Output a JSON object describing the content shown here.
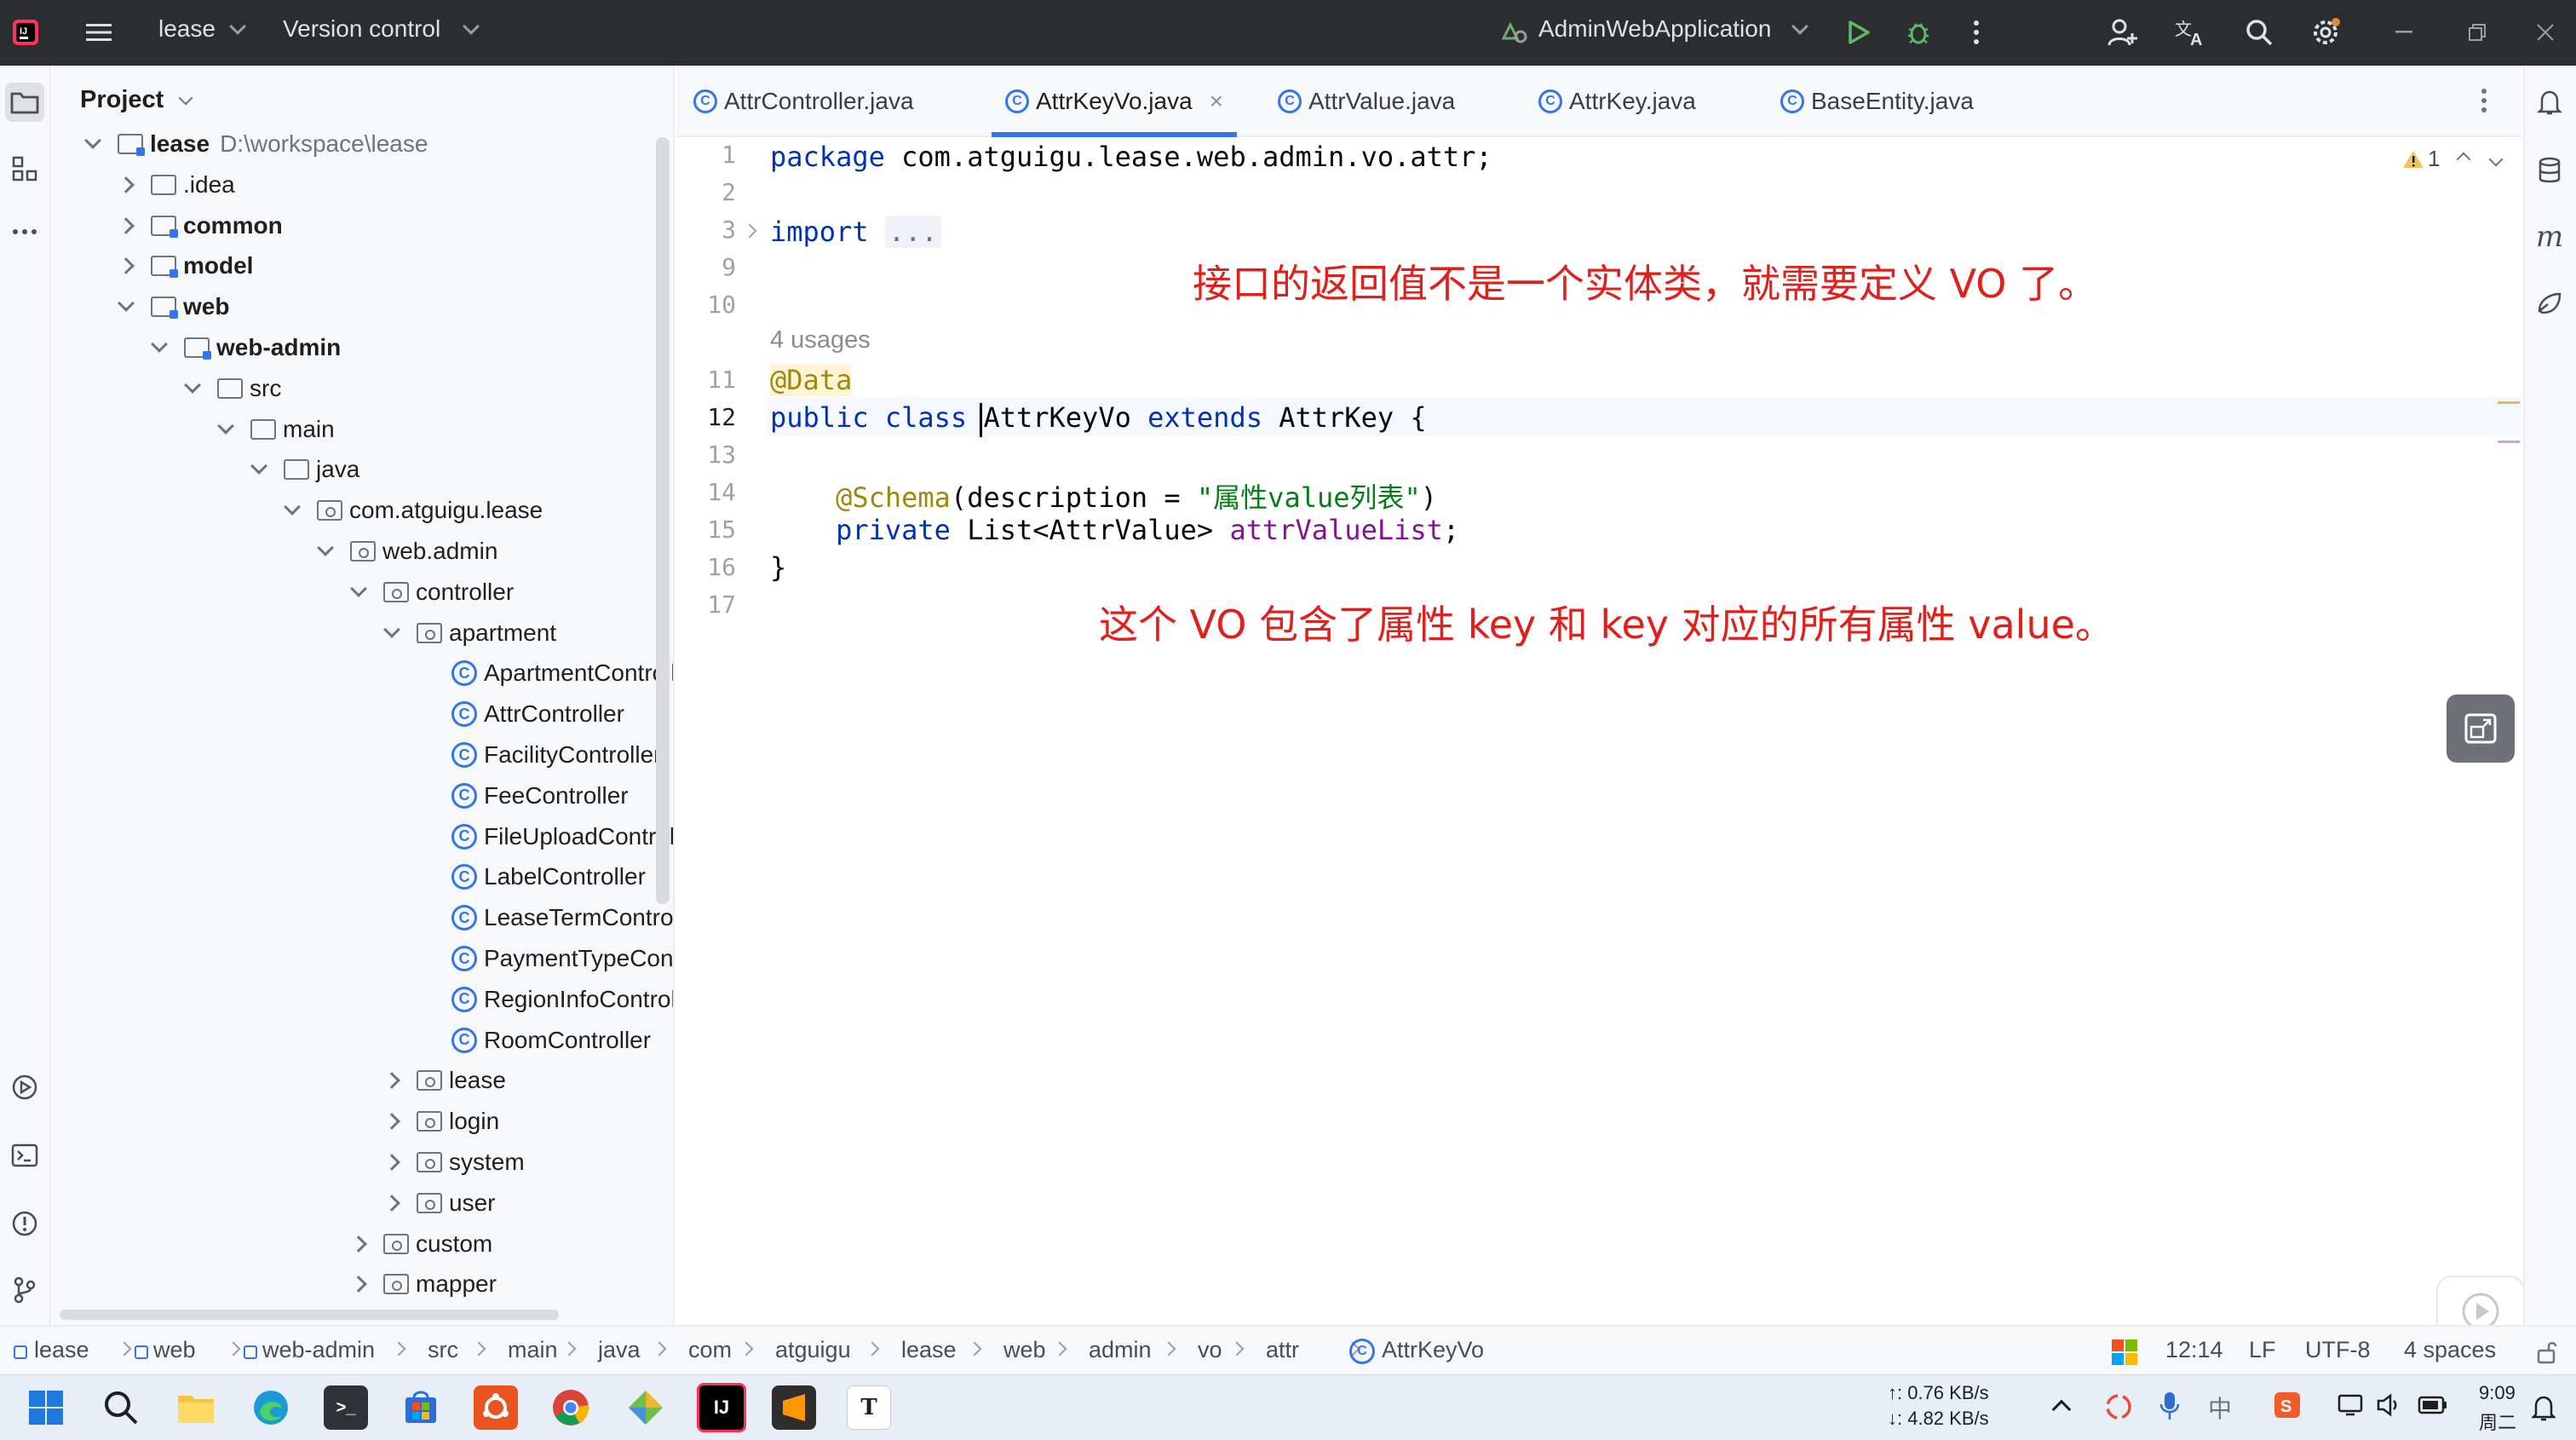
{
  "title_bar": {
    "project_name": "lease",
    "vcs_label": "Version control",
    "run_config": "AdminWebApplication"
  },
  "project_panel": {
    "title": "Project",
    "tree": [
      {
        "label": "lease",
        "path": "D:\\workspace\\lease",
        "level": 0,
        "arrow": "open",
        "icon": "module",
        "bold": true
      },
      {
        "label": ".idea",
        "level": 1,
        "arrow": "closed",
        "icon": "folder"
      },
      {
        "label": "common",
        "level": 1,
        "arrow": "closed",
        "icon": "module",
        "bold": true
      },
      {
        "label": "model",
        "level": 1,
        "arrow": "closed",
        "icon": "module",
        "bold": true
      },
      {
        "label": "web",
        "level": 1,
        "arrow": "open",
        "icon": "module",
        "bold": true
      },
      {
        "label": "web-admin",
        "level": 2,
        "arrow": "open",
        "icon": "module",
        "bold": true
      },
      {
        "label": "src",
        "level": 3,
        "arrow": "open",
        "icon": "folder"
      },
      {
        "label": "main",
        "level": 4,
        "arrow": "open",
        "icon": "folder"
      },
      {
        "label": "java",
        "level": 5,
        "arrow": "open",
        "icon": "source-folder"
      },
      {
        "label": "com.atguigu.lease",
        "level": 6,
        "arrow": "open",
        "icon": "package"
      },
      {
        "label": "web.admin",
        "level": 7,
        "arrow": "open",
        "icon": "package"
      },
      {
        "label": "controller",
        "level": 8,
        "arrow": "open",
        "icon": "package"
      },
      {
        "label": "apartment",
        "level": 9,
        "arrow": "open",
        "icon": "package"
      },
      {
        "label": "ApartmentControll",
        "level": 10,
        "arrow": "none",
        "icon": "class"
      },
      {
        "label": "AttrController",
        "level": 10,
        "arrow": "none",
        "icon": "class"
      },
      {
        "label": "FacilityController",
        "level": 10,
        "arrow": "none",
        "icon": "class"
      },
      {
        "label": "FeeController",
        "level": 10,
        "arrow": "none",
        "icon": "class"
      },
      {
        "label": "FileUploadControll",
        "level": 10,
        "arrow": "none",
        "icon": "class"
      },
      {
        "label": "LabelController",
        "level": 10,
        "arrow": "none",
        "icon": "class"
      },
      {
        "label": "LeaseTermControl",
        "level": 10,
        "arrow": "none",
        "icon": "class"
      },
      {
        "label": "PaymentTypeCont",
        "level": 10,
        "arrow": "none",
        "icon": "class"
      },
      {
        "label": "RegionInfoControll",
        "level": 10,
        "arrow": "none",
        "icon": "class"
      },
      {
        "label": "RoomController",
        "level": 10,
        "arrow": "none",
        "icon": "class"
      },
      {
        "label": "lease",
        "level": 9,
        "arrow": "closed",
        "icon": "package"
      },
      {
        "label": "login",
        "level": 9,
        "arrow": "closed",
        "icon": "package"
      },
      {
        "label": "system",
        "level": 9,
        "arrow": "closed",
        "icon": "package"
      },
      {
        "label": "user",
        "level": 9,
        "arrow": "closed",
        "icon": "package"
      },
      {
        "label": "custom",
        "level": 8,
        "arrow": "closed",
        "icon": "package"
      },
      {
        "label": "mapper",
        "level": 8,
        "arrow": "closed",
        "icon": "package"
      }
    ]
  },
  "tabs": [
    {
      "label": "AttrController.java",
      "active": false
    },
    {
      "label": "AttrKeyVo.java",
      "active": true,
      "close": "×"
    },
    {
      "label": "AttrValue.java",
      "active": false
    },
    {
      "label": "AttrKey.java",
      "active": false
    },
    {
      "label": "BaseEntity.java",
      "active": false
    }
  ],
  "editor": {
    "line_numbers": [
      "1",
      "2",
      "3",
      "9",
      "10",
      "",
      "11",
      "12",
      "13",
      "14",
      "15",
      "16",
      "17"
    ],
    "warning_count": "1",
    "code": {
      "l1_kw": "package",
      "l1_rest": " com.atguigu.lease.web.admin.vo.attr;",
      "l3_kw": "import",
      "l3_fold": "...",
      "usages": "4 usages",
      "l11_ann": "@Data",
      "l12_kw1": "public",
      "l12_kw2": "class",
      "l12_name": "AttrKeyVo",
      "l12_kw3": "extends",
      "l12_rest": " AttrKey {",
      "l14_ann": "@Schema",
      "l14_mid": "(description = ",
      "l14_str": "\"属性value列表\"",
      "l14_end": ")",
      "l15_kw": "private",
      "l15_type": " List<AttrValue> ",
      "l15_field": "attrValueList",
      "l15_end": ";",
      "l16": "}"
    },
    "overlay_note_1": "接口的返回值不是一个实体类，就需要定义 VO 了。",
    "overlay_note_2": "这个 VO 包含了属性 key 和 key 对应的所有属性 value。"
  },
  "breadcrumb": [
    "lease",
    "web",
    "web-admin",
    "src",
    "main",
    "java",
    "com",
    "atguigu",
    "lease",
    "web",
    "admin",
    "vo",
    "attr",
    "AttrKeyVo"
  ],
  "status": {
    "position": "12:14",
    "line_ending": "LF",
    "encoding": "UTF-8",
    "indent": "4 spaces"
  },
  "taskbar": {
    "upload_speed": "↑: 0.76 KB/s",
    "download_speed": "↓: 4.82 KB/s",
    "time": "9:09",
    "day": "周二"
  },
  "colors": {
    "accent": "#3574f0",
    "overlay_text": "#e0201b",
    "keyword": "#0033b3",
    "annotation": "#9e880d",
    "string": "#067d17",
    "field": "#871094"
  }
}
